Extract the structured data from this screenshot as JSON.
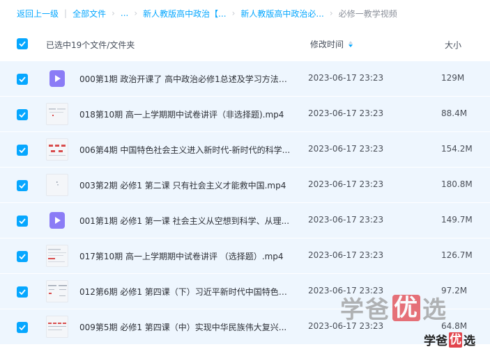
{
  "breadcrumb": {
    "back": "返回上一级",
    "all_files": "全部文件",
    "ellipsis": "...",
    "level1": "新人教版高中政治【...",
    "level2": "新人教版高中政治必...",
    "current": "必修一教学视频"
  },
  "header": {
    "selection_label": "已选中19个文件/文件夹",
    "modified_label": "修改时间",
    "size_label": "大小"
  },
  "files": [
    {
      "name": "000第1期 政治开课了 高中政治必修1总述及学习方法、...",
      "time": "2023-06-17 23:23",
      "size": "129M",
      "thumb": "video-icon"
    },
    {
      "name": "018第10期 高一上学期期中试卷讲评（非选择题).mp4",
      "time": "2023-06-17 23:23",
      "size": "88.4M",
      "thumb": "video-thumbnail"
    },
    {
      "name": "006第4期 中国特色社会主义进入新时代-新时代的科学...",
      "time": "2023-06-17 23:23",
      "size": "154.2M",
      "thumb": "video-thumbnail"
    },
    {
      "name": "003第2期 必修1 第二课 只有社会主义才能救中国.mp4",
      "time": "2023-06-17 23:23",
      "size": "180.8M",
      "thumb": "video-thumbnail"
    },
    {
      "name": "001第1期 必修1 第一课 社会主义从空想到科学、从理...",
      "time": "2023-06-17 23:23",
      "size": "149.7M",
      "thumb": "video-icon"
    },
    {
      "name": "017第10期 高一上学期期中试卷讲评 （选择题）.mp4",
      "time": "2023-06-17 23:23",
      "size": "126.7M",
      "thumb": "video-thumbnail"
    },
    {
      "name": "012第6期 必修1 第四课（下）习近平新时代中国特色社...",
      "time": "2023-06-17 23:23",
      "size": "97.2M",
      "thumb": "video-thumbnail"
    },
    {
      "name": "009第5期 必修1 第四课（中）实现中华民族伟大复兴...",
      "time": "2023-06-17 23:23",
      "size": "64.8M",
      "thumb": "video-thumbnail"
    }
  ],
  "watermark": {
    "big_1": "学",
    "big_2": "爸",
    "big_3": "优",
    "big_4": "选",
    "small_1": "学",
    "small_2": "爸",
    "small_3": "优",
    "small_4": "选"
  },
  "colors": {
    "accent": "#06a7ff",
    "row_selected_bg": "#eef6fe",
    "video_icon": "#8b7cf6",
    "watermark_red": "#e2444c"
  }
}
